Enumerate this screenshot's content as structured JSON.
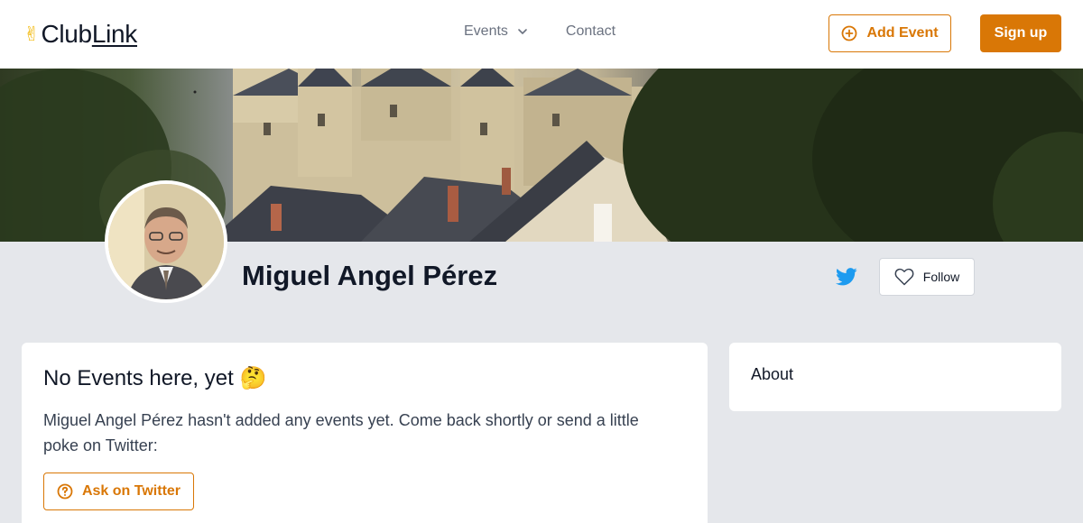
{
  "header": {
    "logo": {
      "emoji": "✌",
      "text_main": "Club",
      "text_link": "Link"
    },
    "nav": [
      {
        "label": "Events",
        "has_dropdown": true,
        "icon": "chevron-down-icon"
      },
      {
        "label": "Contact"
      }
    ],
    "add_event_label": "Add Event",
    "add_event_icon": "plus-circle-icon",
    "signup_label": "Sign up"
  },
  "profile": {
    "name": "Miguel Angel Pérez",
    "social_icon": "twitter-icon",
    "follow_label": "Follow",
    "follow_icon": "heart-icon"
  },
  "events_card": {
    "title": "No Events here, yet 🤔",
    "text": "Miguel Angel Pérez hasn't added any events yet. Come back shortly or send a little poke on Twitter:",
    "ask_label": "Ask on Twitter",
    "ask_icon": "question-circle-icon"
  },
  "about_card": {
    "title": "About"
  },
  "colors": {
    "accent": "#d97706",
    "background": "#e5e7eb",
    "twitter": "#1d9bf0"
  }
}
